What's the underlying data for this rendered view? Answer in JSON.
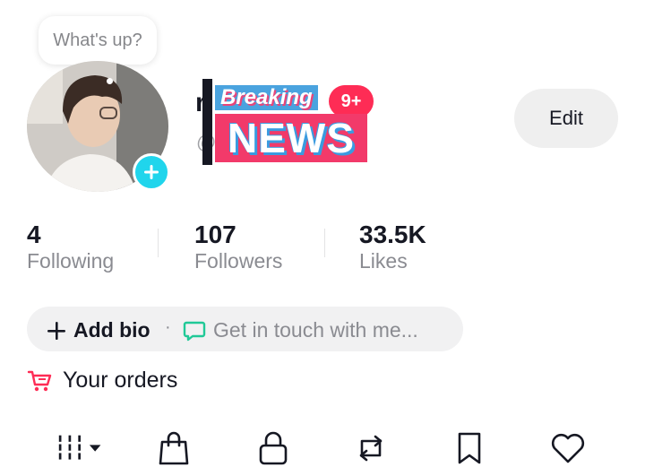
{
  "bubble": {
    "text": "What's up?"
  },
  "profile": {
    "name_visible": "r",
    "handle_visible": "@"
  },
  "sticker": {
    "breaking": "Breaking",
    "badge": "9+",
    "news": "NEWS"
  },
  "edit_label": "Edit",
  "stats": [
    {
      "value": "4",
      "label": "Following"
    },
    {
      "value": "107",
      "label": "Followers"
    },
    {
      "value": "33.5K",
      "label": "Likes"
    }
  ],
  "bio": {
    "add_label": "Add bio",
    "separator": "·",
    "contact_label": "Get in touch with me..."
  },
  "orders": {
    "label": "Your orders"
  },
  "tabs": [
    "videos-grid-icon",
    "shop-bag-icon",
    "lock-icon",
    "repost-icon",
    "bookmark-icon",
    "heart-icon"
  ],
  "colors": {
    "accent": "#fe2c55",
    "avatar_add": "#20d5ec",
    "contact_icon": "#20c997"
  }
}
